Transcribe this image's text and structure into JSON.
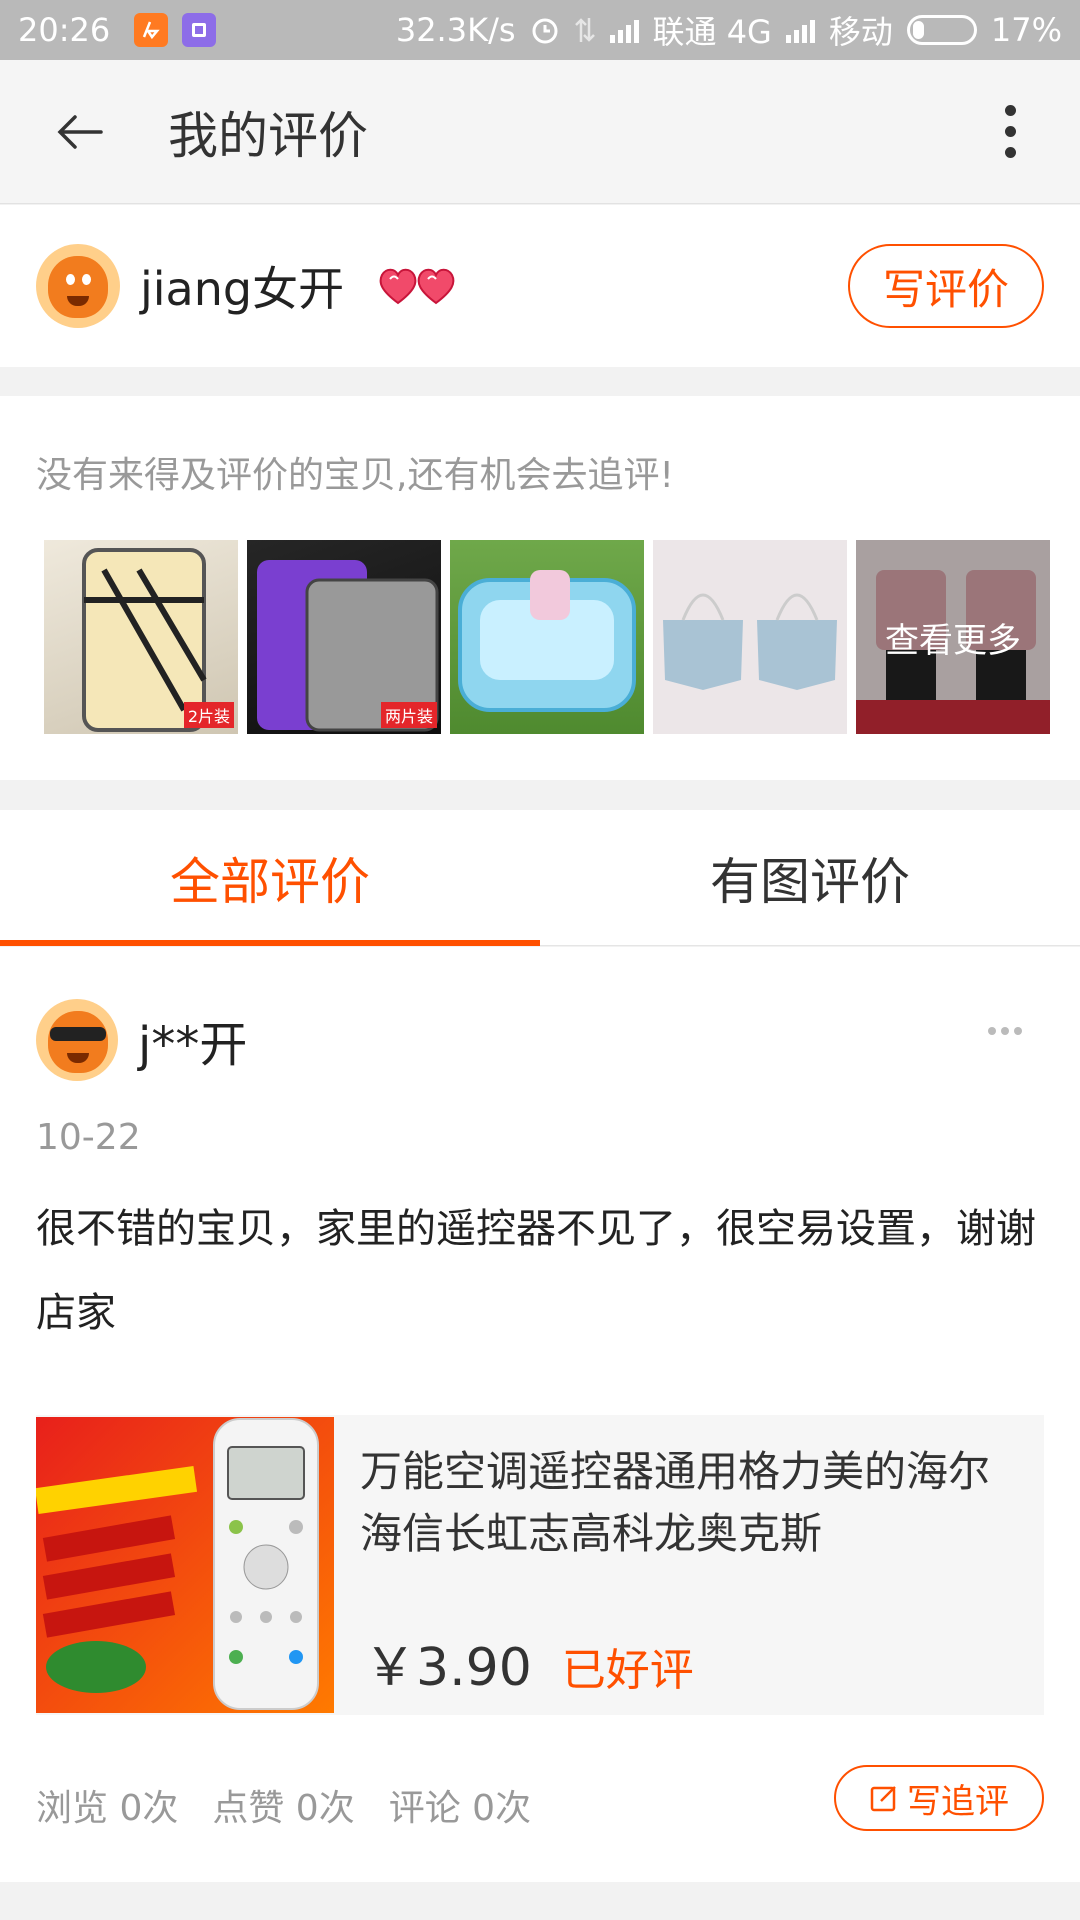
{
  "status_bar": {
    "time": "20:26",
    "network_speed": "32.3K/s",
    "carrier1": "联通 4G",
    "carrier2": "移动",
    "battery": "17%",
    "icons": [
      "taobao-app-icon",
      "notification-app-icon",
      "alarm-icon",
      "data-transfer-icon",
      "signal-icon",
      "battery-icon"
    ]
  },
  "header": {
    "title": "我的评价",
    "back_icon": "arrow-left-icon",
    "more_icon": "more-vertical-icon"
  },
  "user": {
    "name": "jiang女开",
    "level_icon": "heart-level-icon",
    "write_review_label": "写评价"
  },
  "pending": {
    "tip": "没有来得及评价的宝贝,还有机会去追评!",
    "items": [
      {
        "label": "2片装",
        "colors": [
          "#d8cfc0",
          "#f4e7c2"
        ]
      },
      {
        "label": "两片装",
        "colors": [
          "#1b1b1b",
          "#7a3fd0"
        ]
      },
      {
        "label": "",
        "colors": [
          "#6ba63e",
          "#8fd6ef"
        ]
      },
      {
        "label": "",
        "colors": [
          "#f0e9ea",
          "#a9c3d4"
        ]
      },
      {
        "label": "",
        "colors": [
          "#e7dada",
          "#d7a3a8"
        ]
      }
    ],
    "see_more_label": "查看更多"
  },
  "tabs": [
    {
      "label": "全部评价",
      "active": true
    },
    {
      "label": "有图评价",
      "active": false
    }
  ],
  "review": {
    "user": "j**开",
    "date": "10-22",
    "text": "很不错的宝贝，家里的遥控器不见了，很空易设置，谢谢店家",
    "product": {
      "title": "万能空调遥控器通用格力美的海尔海信长虹志高科龙奥克斯",
      "price": "￥3.90",
      "status": "已好评"
    },
    "stats": {
      "views": "浏览 0次",
      "likes": "点赞 0次",
      "comments": "评论 0次"
    },
    "append_label": "写追评"
  },
  "colors": {
    "accent": "#ff5000",
    "page_bg": "#f2f2f2",
    "status_bar": "#b9b9b9"
  }
}
